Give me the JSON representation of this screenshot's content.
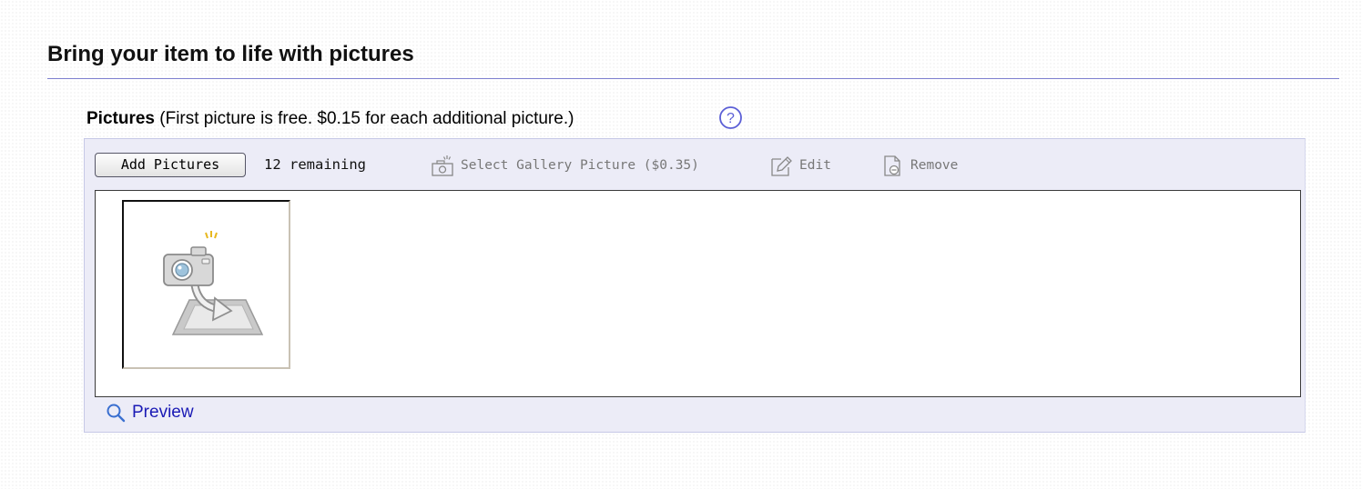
{
  "section": {
    "title": "Bring your item to life with pictures"
  },
  "pictures": {
    "label": "Pictures",
    "note": "(First picture is free. $0.15 for each additional picture.)",
    "help_icon": "question-circle-icon"
  },
  "toolbar": {
    "add_label": "Add Pictures",
    "remaining": "12 remaining",
    "gallery_label": "Select Gallery Picture ($0.35)",
    "gallery_icon": "camera-icon",
    "edit_label": "Edit",
    "edit_icon": "pencil-icon",
    "remove_label": "Remove",
    "remove_icon": "document-remove-icon"
  },
  "thumbnail": {
    "icon": "camera-upload-icon"
  },
  "preview": {
    "label": "Preview",
    "icon": "magnifier-icon"
  },
  "colors": {
    "accent_link": "#1a1ab5",
    "rule": "#7d7fcf",
    "panel_bg": "#ececf7",
    "help_icon": "#5b5fd6",
    "disabled_text": "#777777"
  }
}
